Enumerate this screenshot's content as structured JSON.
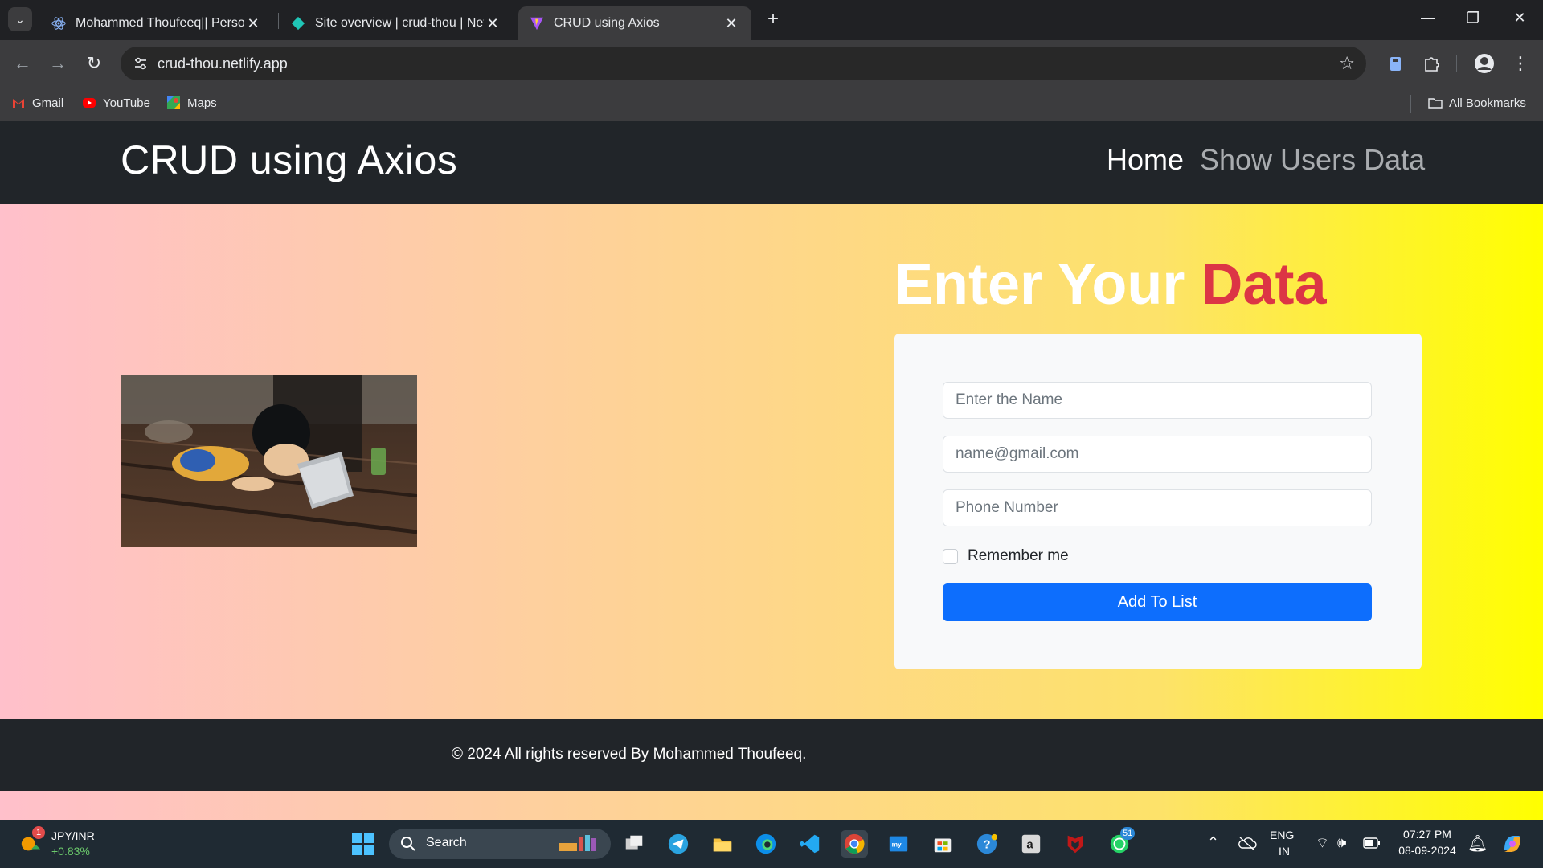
{
  "browser": {
    "tabs": [
      {
        "title": "Mohammed Thoufeeq|| Personal"
      },
      {
        "title": "Site overview | crud-thou | Netlify"
      },
      {
        "title": "CRUD using Axios"
      }
    ],
    "url": "crud-thou.netlify.app",
    "bookmarks": [
      {
        "label": "Gmail"
      },
      {
        "label": "YouTube"
      },
      {
        "label": "Maps"
      }
    ],
    "all_bookmarks": "All Bookmarks"
  },
  "site": {
    "brand": "CRUD using Axios",
    "nav": {
      "home": "Home",
      "users": "Show Users Data"
    },
    "form": {
      "title_part1": "Enter Your",
      "title_part2": "Data",
      "name_placeholder": "Enter the Name",
      "email_placeholder": "name@gmail.com",
      "phone_placeholder": "Phone Number",
      "remember_label": "Remember me",
      "submit_label": "Add To List"
    },
    "footer": "© 2024 All rights reserved By Mohammed Thoufeeq."
  },
  "taskbar": {
    "ticker_symbol": "JPY/INR",
    "ticker_change": "+0.83%",
    "ticker_badge": "1",
    "search_label": "Search",
    "whatsapp_badge": "51",
    "lang_top": "ENG",
    "lang_bottom": "IN",
    "time": "07:27 PM",
    "date": "08-09-2024"
  },
  "colors": {
    "accent_red": "#dc3545",
    "button_blue": "#0d6efd",
    "nav_dark": "#212529"
  }
}
